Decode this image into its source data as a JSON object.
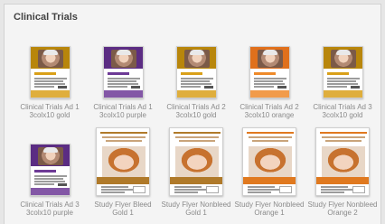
{
  "section": {
    "title": "Clinical Trials"
  },
  "items": [
    {
      "line1": "Clinical Trials Ad 1",
      "line2": "3colx10 gold",
      "kind": "ad",
      "band": "#b8860b",
      "accent": "#d9a01a"
    },
    {
      "line1": "Clinical Trials Ad 1",
      "line2": "3colx10 purple",
      "kind": "ad",
      "band": "#5b2c83",
      "accent": "#6d3a96"
    },
    {
      "line1": "Clinical Trials Ad 2",
      "line2": "3colx10 gold",
      "kind": "ad",
      "band": "#b8860b",
      "accent": "#d9a01a"
    },
    {
      "line1": "Clinical Trials Ad 2",
      "line2": "3colx10 orange",
      "kind": "ad",
      "band": "#e0701c",
      "accent": "#ee8a2a"
    },
    {
      "line1": "Clinical Trials Ad 3",
      "line2": "3colx10 gold",
      "kind": "ad",
      "band": "#b8860b",
      "accent": "#d9a01a"
    },
    {
      "line1": "Clinical Trials Ad 3",
      "line2": "3colx10 purple",
      "kind": "ad",
      "band": "#5b2c83",
      "accent": "#6d3a96"
    },
    {
      "line1": "Study Flyer Bleed",
      "line2": "Gold 1",
      "kind": "flyer",
      "accent": "#b07a2a"
    },
    {
      "line1": "Study Flyer Nonbleed",
      "line2": "Gold 1",
      "kind": "flyer",
      "accent": "#b07a2a"
    },
    {
      "line1": "Study Flyer Nonbleed",
      "line2": "Orange 1",
      "kind": "flyer",
      "accent": "#e0791f"
    },
    {
      "line1": "Study Flyer Nonbleed",
      "line2": "Orange 2",
      "kind": "flyer",
      "accent": "#e0791f"
    }
  ]
}
